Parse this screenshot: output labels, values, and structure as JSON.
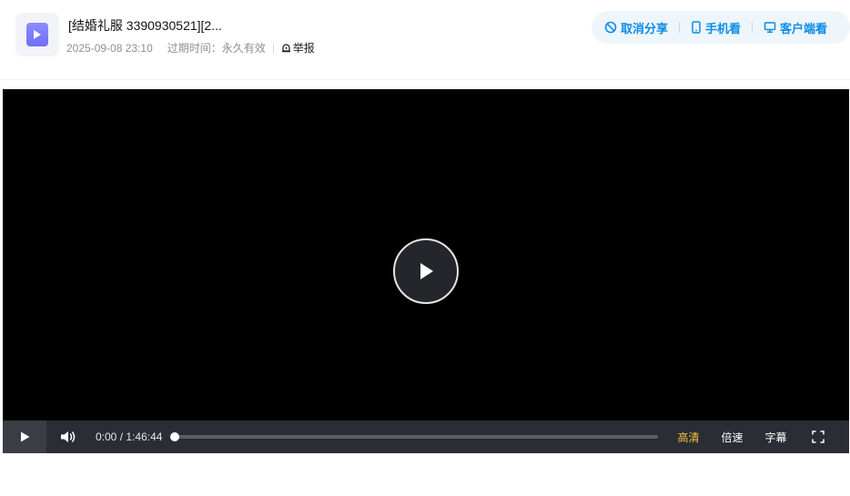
{
  "file": {
    "title": "[结婚礼服 3390930521][2...",
    "date": "2025-09-08 23:10",
    "expire": "过期时间：永久有效",
    "report_label": "举报",
    "icon": "video-file-icon"
  },
  "actions": [
    {
      "label": "取消分享",
      "icon": "cancel-share-icon"
    },
    {
      "label": "手机看",
      "icon": "phone-icon"
    },
    {
      "label": "客户端看",
      "icon": "monitor-icon"
    }
  ],
  "player": {
    "current_time": "0:00",
    "separator": "/",
    "duration": "1:46:44",
    "progress": 0.0,
    "quality_label": "高清",
    "speed_label": "倍速",
    "subtitle_label": "字幕"
  },
  "colors": {
    "accent": "#0d8ce8",
    "quality": "#f5c03b",
    "file_icon": "#7b7bf8"
  }
}
